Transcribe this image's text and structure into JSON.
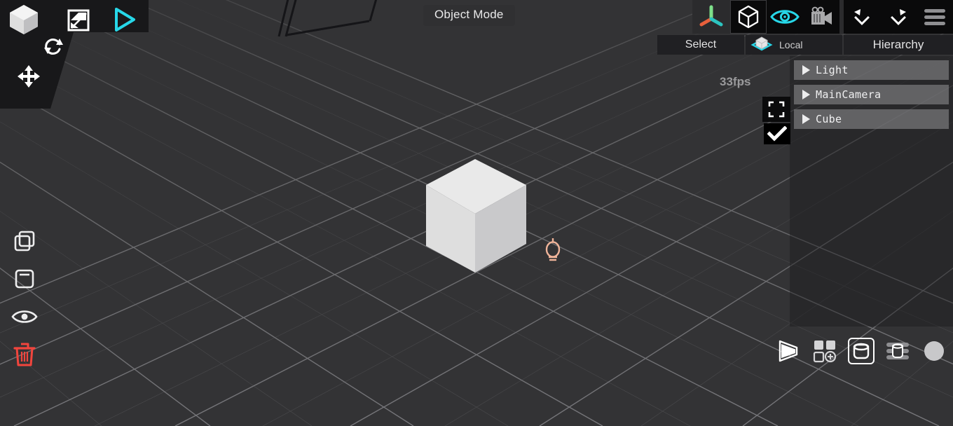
{
  "app": {
    "mode_label": "Object Mode",
    "fps": "33fps",
    "accent_cyan": "#27d7e8",
    "accent_red": "#f2453d",
    "viewport_bg": "#333335",
    "panel_black": "#18181a"
  },
  "left_tools": {
    "items": [
      {
        "name": "object-tool",
        "icon": "cube-icon",
        "label": "Object"
      },
      {
        "name": "scale-tool",
        "icon": "scale-icon",
        "label": "Scale"
      },
      {
        "name": "play-tool",
        "icon": "play-icon",
        "label": "Play"
      },
      {
        "name": "rotate-tool",
        "icon": "rotate-icon",
        "label": "Rotate"
      },
      {
        "name": "move-tool",
        "icon": "move-icon",
        "label": "Move"
      }
    ]
  },
  "left_strip": {
    "items": [
      {
        "name": "duplicate-button",
        "icon": "copy-icon",
        "label": "Duplicate"
      },
      {
        "name": "paste-button",
        "icon": "paste-icon",
        "label": "Paste"
      },
      {
        "name": "visibility-button",
        "icon": "eye-icon",
        "label": "Visibility"
      },
      {
        "name": "delete-button",
        "icon": "trash-icon",
        "label": "Delete"
      }
    ]
  },
  "top_right": {
    "gizmo_label": "axis-gizmo",
    "buttons": [
      {
        "name": "shape-mode-button",
        "icon": "cube-outline-icon",
        "label": "Shape",
        "active": true
      },
      {
        "name": "visibility-button",
        "icon": "eye-icon",
        "label": "Visibility",
        "active": true
      },
      {
        "name": "camera-button",
        "icon": "video-camera-icon",
        "label": "Camera",
        "active": false
      },
      {
        "name": "undo-button",
        "icon": "undo-icon",
        "label": "Undo",
        "active": false
      },
      {
        "name": "redo-button",
        "icon": "redo-icon",
        "label": "Redo",
        "active": false
      },
      {
        "name": "menu-button",
        "icon": "hamburger-icon",
        "label": "Menu",
        "active": false
      }
    ]
  },
  "second_row": {
    "select_label": "Select",
    "local_label": "Local",
    "hierarchy_label": "Hierarchy"
  },
  "hierarchy": {
    "title": "Hierarchy",
    "items": [
      {
        "name": "Light"
      },
      {
        "name": "MainCamera"
      },
      {
        "name": "Cube"
      }
    ]
  },
  "overlay": {
    "focus_label": "Focus",
    "confirm_label": "Confirm"
  },
  "bottom_right": {
    "items": [
      {
        "name": "shading-button",
        "icon": "shading-icon",
        "label": "Shading",
        "active": false
      },
      {
        "name": "add-object-button",
        "icon": "add-grid-icon",
        "label": "Add",
        "active": false
      },
      {
        "name": "object-button",
        "icon": "object-icon",
        "label": "Object",
        "active": true
      },
      {
        "name": "list-button",
        "icon": "list-icon",
        "label": "List",
        "active": false
      },
      {
        "name": "material-button",
        "icon": "sphere-icon",
        "label": "Material",
        "active": false
      }
    ]
  },
  "scene": {
    "objects": [
      {
        "name": "Cube",
        "type": "mesh",
        "top_color": "#e8e8e8",
        "left_color": "#dcdcdc",
        "right_color": "#c9c9ca"
      },
      {
        "name": "Light",
        "type": "light",
        "gizmo_color": "#f0b49a"
      },
      {
        "name": "MainCamera",
        "type": "camera",
        "gizmo_color": "#15151a"
      }
    ],
    "grid_color": "#575759"
  }
}
